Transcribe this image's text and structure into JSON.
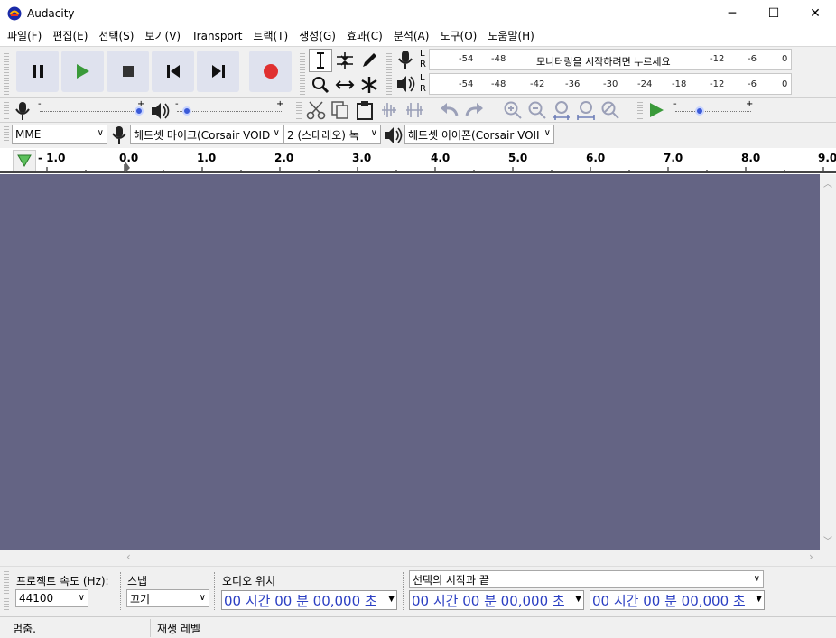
{
  "window": {
    "title": "Audacity",
    "minimize": "─",
    "maximize": "☐",
    "close": "✕"
  },
  "menu": [
    "파일(F)",
    "편집(E)",
    "선택(S)",
    "보기(V)",
    "Transport",
    "트랙(T)",
    "생성(G)",
    "효과(C)",
    "분석(A)",
    "도구(O)",
    "도움말(H)"
  ],
  "meter": {
    "record_channels": [
      "L",
      "R"
    ],
    "play_channels": [
      "L",
      "R"
    ],
    "record_ticks": [
      "-54",
      "-48",
      "-12",
      "-6",
      "0"
    ],
    "record_prompt": "모니터링을 시작하려면 누르세요",
    "play_ticks": [
      "-54",
      "-48",
      "-42",
      "-36",
      "-30",
      "-24",
      "-18",
      "-12",
      "-6",
      "0"
    ]
  },
  "mixer": {
    "minus": "-",
    "plus": "+",
    "record_volume": 0.95,
    "play_volume": 0.05,
    "play_speed": 0.3
  },
  "device": {
    "host": "MME",
    "input": "헤드셋 마이크(Corsair VOID",
    "channels": "2 (스테레오) 녹",
    "output": "헤드셋 이어폰(Corsair VOII"
  },
  "ruler": {
    "labels": [
      "- 1.0",
      "0.0",
      "1.0",
      "2.0",
      "3.0",
      "4.0",
      "5.0",
      "6.0",
      "7.0",
      "8.0",
      "9.0"
    ]
  },
  "selection": {
    "rate_label": "프로젝트 속도 (Hz):",
    "rate_value": "44100",
    "snap_label": "스냅",
    "snap_value": "끄기",
    "audio_pos_label": "오디오 위치",
    "audio_pos_value": "00 시간 00 분 00,000 초",
    "sel_mode": "선택의 시작과 끝",
    "sel_start": "00 시간 00 분 00,000 초",
    "sel_end": "00 시간 00 분 00,000 초"
  },
  "status": {
    "state": "멈춤.",
    "level": "재생 레벨"
  },
  "colors": {
    "track_bg": "#646484",
    "toolbar_bg": "#f0f0f0",
    "button_bg": "#dfe2ee",
    "play_green": "#3a9a3a",
    "record_red": "#e03030",
    "timecode_blue": "#2b3fc3"
  }
}
